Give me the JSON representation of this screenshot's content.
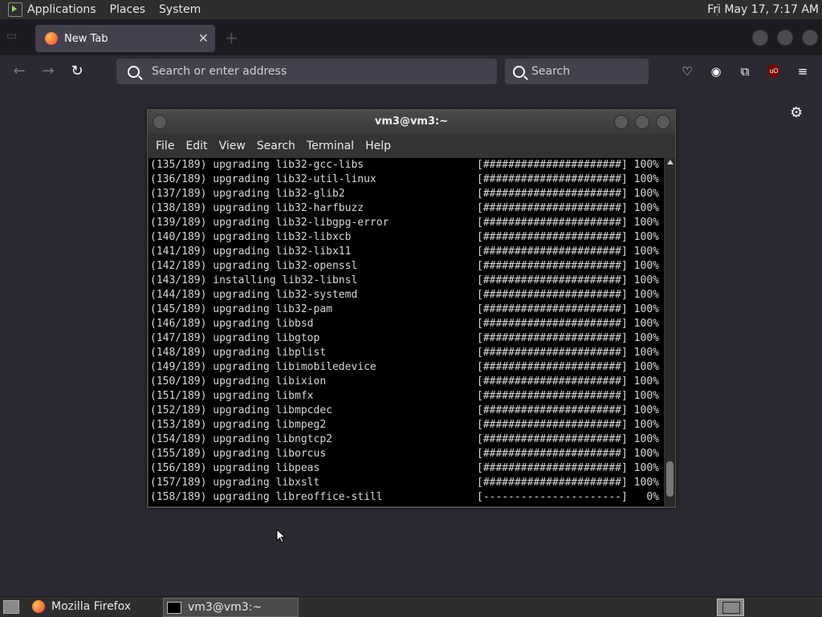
{
  "top_panel": {
    "menus": [
      "Applications",
      "Places",
      "System"
    ],
    "clock": "Fri May 17,  7:17 AM"
  },
  "firefox": {
    "tab_title": "New Tab",
    "url_placeholder": "Search or enter address",
    "search_placeholder": "Search",
    "ublock_badge": "uO"
  },
  "terminal": {
    "title": "vm3@vm3:~",
    "menu": [
      "File",
      "Edit",
      "View",
      "Search",
      "Terminal",
      "Help"
    ],
    "lines": [
      {
        "text": "(135/189) upgrading lib32-gcc-libs",
        "bar": "[######################]",
        "pct": " 100%"
      },
      {
        "text": "(136/189) upgrading lib32-util-linux",
        "bar": "[######################]",
        "pct": " 100%"
      },
      {
        "text": "(137/189) upgrading lib32-glib2",
        "bar": "[######################]",
        "pct": " 100%"
      },
      {
        "text": "(138/189) upgrading lib32-harfbuzz",
        "bar": "[######################]",
        "pct": " 100%"
      },
      {
        "text": "(139/189) upgrading lib32-libgpg-error",
        "bar": "[######################]",
        "pct": " 100%"
      },
      {
        "text": "(140/189) upgrading lib32-libxcb",
        "bar": "[######################]",
        "pct": " 100%"
      },
      {
        "text": "(141/189) upgrading lib32-libx11",
        "bar": "[######################]",
        "pct": " 100%"
      },
      {
        "text": "(142/189) upgrading lib32-openssl",
        "bar": "[######################]",
        "pct": " 100%"
      },
      {
        "text": "(143/189) installing lib32-libnsl",
        "bar": "[######################]",
        "pct": " 100%"
      },
      {
        "text": "(144/189) upgrading lib32-systemd",
        "bar": "[######################]",
        "pct": " 100%"
      },
      {
        "text": "(145/189) upgrading lib32-pam",
        "bar": "[######################]",
        "pct": " 100%"
      },
      {
        "text": "(146/189) upgrading libbsd",
        "bar": "[######################]",
        "pct": " 100%"
      },
      {
        "text": "(147/189) upgrading libgtop",
        "bar": "[######################]",
        "pct": " 100%"
      },
      {
        "text": "(148/189) upgrading libplist",
        "bar": "[######################]",
        "pct": " 100%"
      },
      {
        "text": "(149/189) upgrading libimobiledevice",
        "bar": "[######################]",
        "pct": " 100%"
      },
      {
        "text": "(150/189) upgrading libixion",
        "bar": "[######################]",
        "pct": " 100%"
      },
      {
        "text": "(151/189) upgrading libmfx",
        "bar": "[######################]",
        "pct": " 100%"
      },
      {
        "text": "(152/189) upgrading libmpcdec",
        "bar": "[######################]",
        "pct": " 100%"
      },
      {
        "text": "(153/189) upgrading libmpeg2",
        "bar": "[######################]",
        "pct": " 100%"
      },
      {
        "text": "(154/189) upgrading libngtcp2",
        "bar": "[######################]",
        "pct": " 100%"
      },
      {
        "text": "(155/189) upgrading liborcus",
        "bar": "[######################]",
        "pct": " 100%"
      },
      {
        "text": "(156/189) upgrading libpeas",
        "bar": "[######################]",
        "pct": " 100%"
      },
      {
        "text": "(157/189) upgrading libxslt",
        "bar": "[######################]",
        "pct": " 100%"
      },
      {
        "text": "(158/189) upgrading libreoffice-still",
        "bar": "[----------------------]",
        "pct": "   0%"
      }
    ]
  },
  "taskbar": {
    "tasks": [
      "Mozilla Firefox",
      "vm3@vm3:~"
    ]
  }
}
